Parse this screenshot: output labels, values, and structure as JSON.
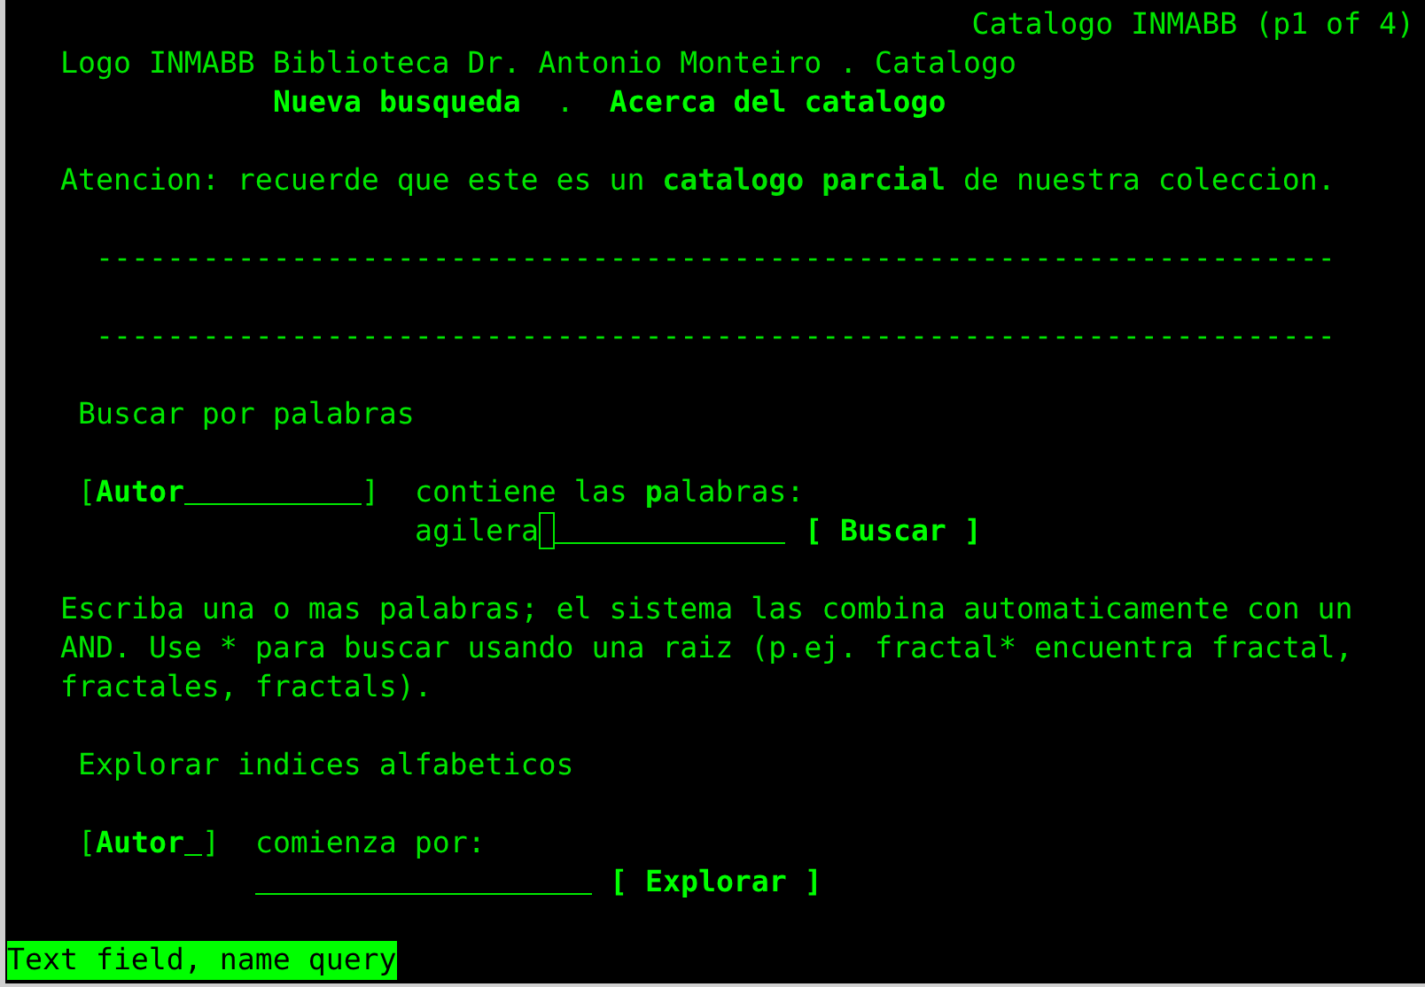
{
  "title": "Catalogo INMABB (p1 of 4)",
  "header": "Logo INMABB Biblioteca Dr. Antonio Monteiro . Catalogo",
  "nav": {
    "links": [
      "Nueva busqueda",
      "Acerca del catalogo"
    ],
    "separator": "."
  },
  "notice": "Atencion: recuerde que este es un **catalogo parcial** de nuestra coleccion.",
  "rules": [
    "----------------------------------------------------------------------",
    "----------------------------------------------------------------------"
  ],
  "search": {
    "heading": "Buscar por palabras",
    "select": {
      "open": "[",
      "value": "Autor",
      "close": "]"
    },
    "label": "contiene las **p**alabras:",
    "input": {
      "value": "agilera",
      "focused": true
    },
    "button": "[ Buscar ]"
  },
  "help": "Escriba una o mas palabras; el sistema las combina automaticamente con un AND. Use * para buscar usando una raiz (p.ej. fractal* encuentra fractal, fractales, fractals).",
  "browse": {
    "heading": "Explorar indices alfabeticos",
    "select": {
      "open": "[",
      "value": "Autor",
      "close": "]"
    },
    "label": "comienza por:",
    "input": {
      "focused": false
    },
    "button": "[ Explorar ]"
  },
  "status_bar": "Text field, name query"
}
